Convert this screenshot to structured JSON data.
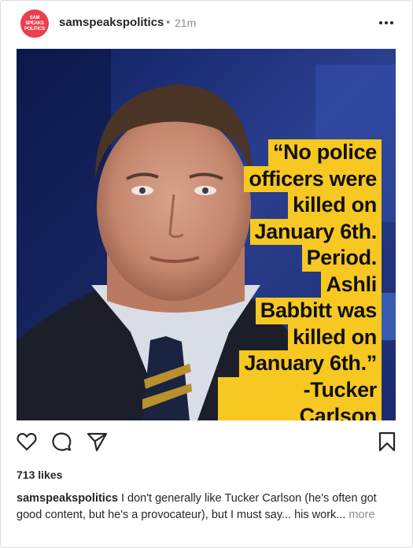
{
  "post": {
    "author": {
      "username": "samspeakspolitics",
      "avatar_text": [
        "SAM",
        "SPEAKS",
        "POLITICS"
      ],
      "avatar_color": "#e8404c"
    },
    "separator": "•",
    "time_ago": "21m",
    "image": {
      "quote_lines": [
        "“No police",
        "officers were",
        "killed on",
        "January 6th.",
        "Period.",
        "Ashli",
        "Babbitt was",
        "killed on",
        "January 6th.”",
        "-Tucker Carlson"
      ],
      "quote_bg_color": "#f7c821",
      "background_color": "#1b2f74"
    },
    "actions": {
      "like_icon": "heart-icon",
      "comment_icon": "comment-icon",
      "share_icon": "share-icon",
      "save_icon": "bookmark-icon"
    },
    "likes_text": "713 likes",
    "caption": {
      "username": "samspeakspolitics",
      "text": " I don't generally like Tucker Carlson (he's often got good content, but he's a provocateur), but I must say... his work...",
      "more_label": " more"
    }
  }
}
